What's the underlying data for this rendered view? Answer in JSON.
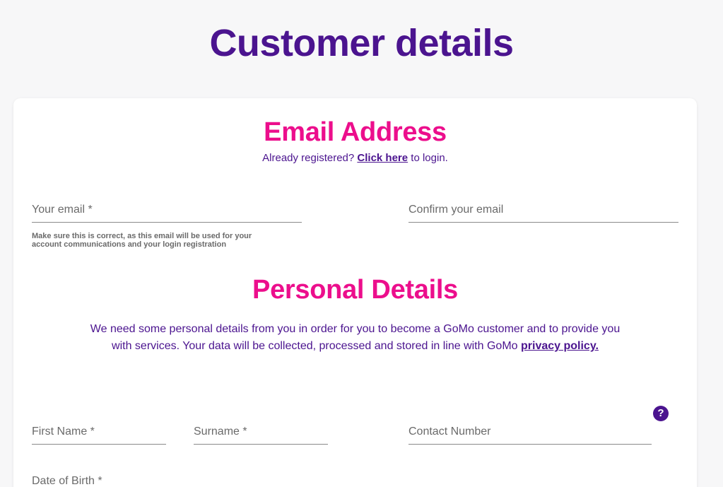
{
  "page": {
    "title": "Customer details"
  },
  "email_section": {
    "title": "Email Address",
    "login_prefix": "Already registered?",
    "login_link": "Click here",
    "login_suffix": "to login.",
    "email_label": "Your email *",
    "confirm_label": "Confirm your email",
    "helper_line1": "Make sure this is correct, as this email will be used for your",
    "helper_line2": "account communications and your login registration"
  },
  "personal_section": {
    "title": "Personal Details",
    "intro_text": "We need some personal details from you in order for you to become a GoMo customer and to provide you with services. Your data will be collected, processed and stored in line with GoMo",
    "privacy_link": "privacy policy.",
    "first_name_label": "First Name *",
    "surname_label": "Surname *",
    "contact_label": "Contact Number",
    "help_icon": "question-mark-icon",
    "help_glyph": "?",
    "dob_label": "Date of Birth *"
  },
  "colors": {
    "brand_purple": "#4b148f",
    "brand_pink": "#ec0e8c"
  }
}
